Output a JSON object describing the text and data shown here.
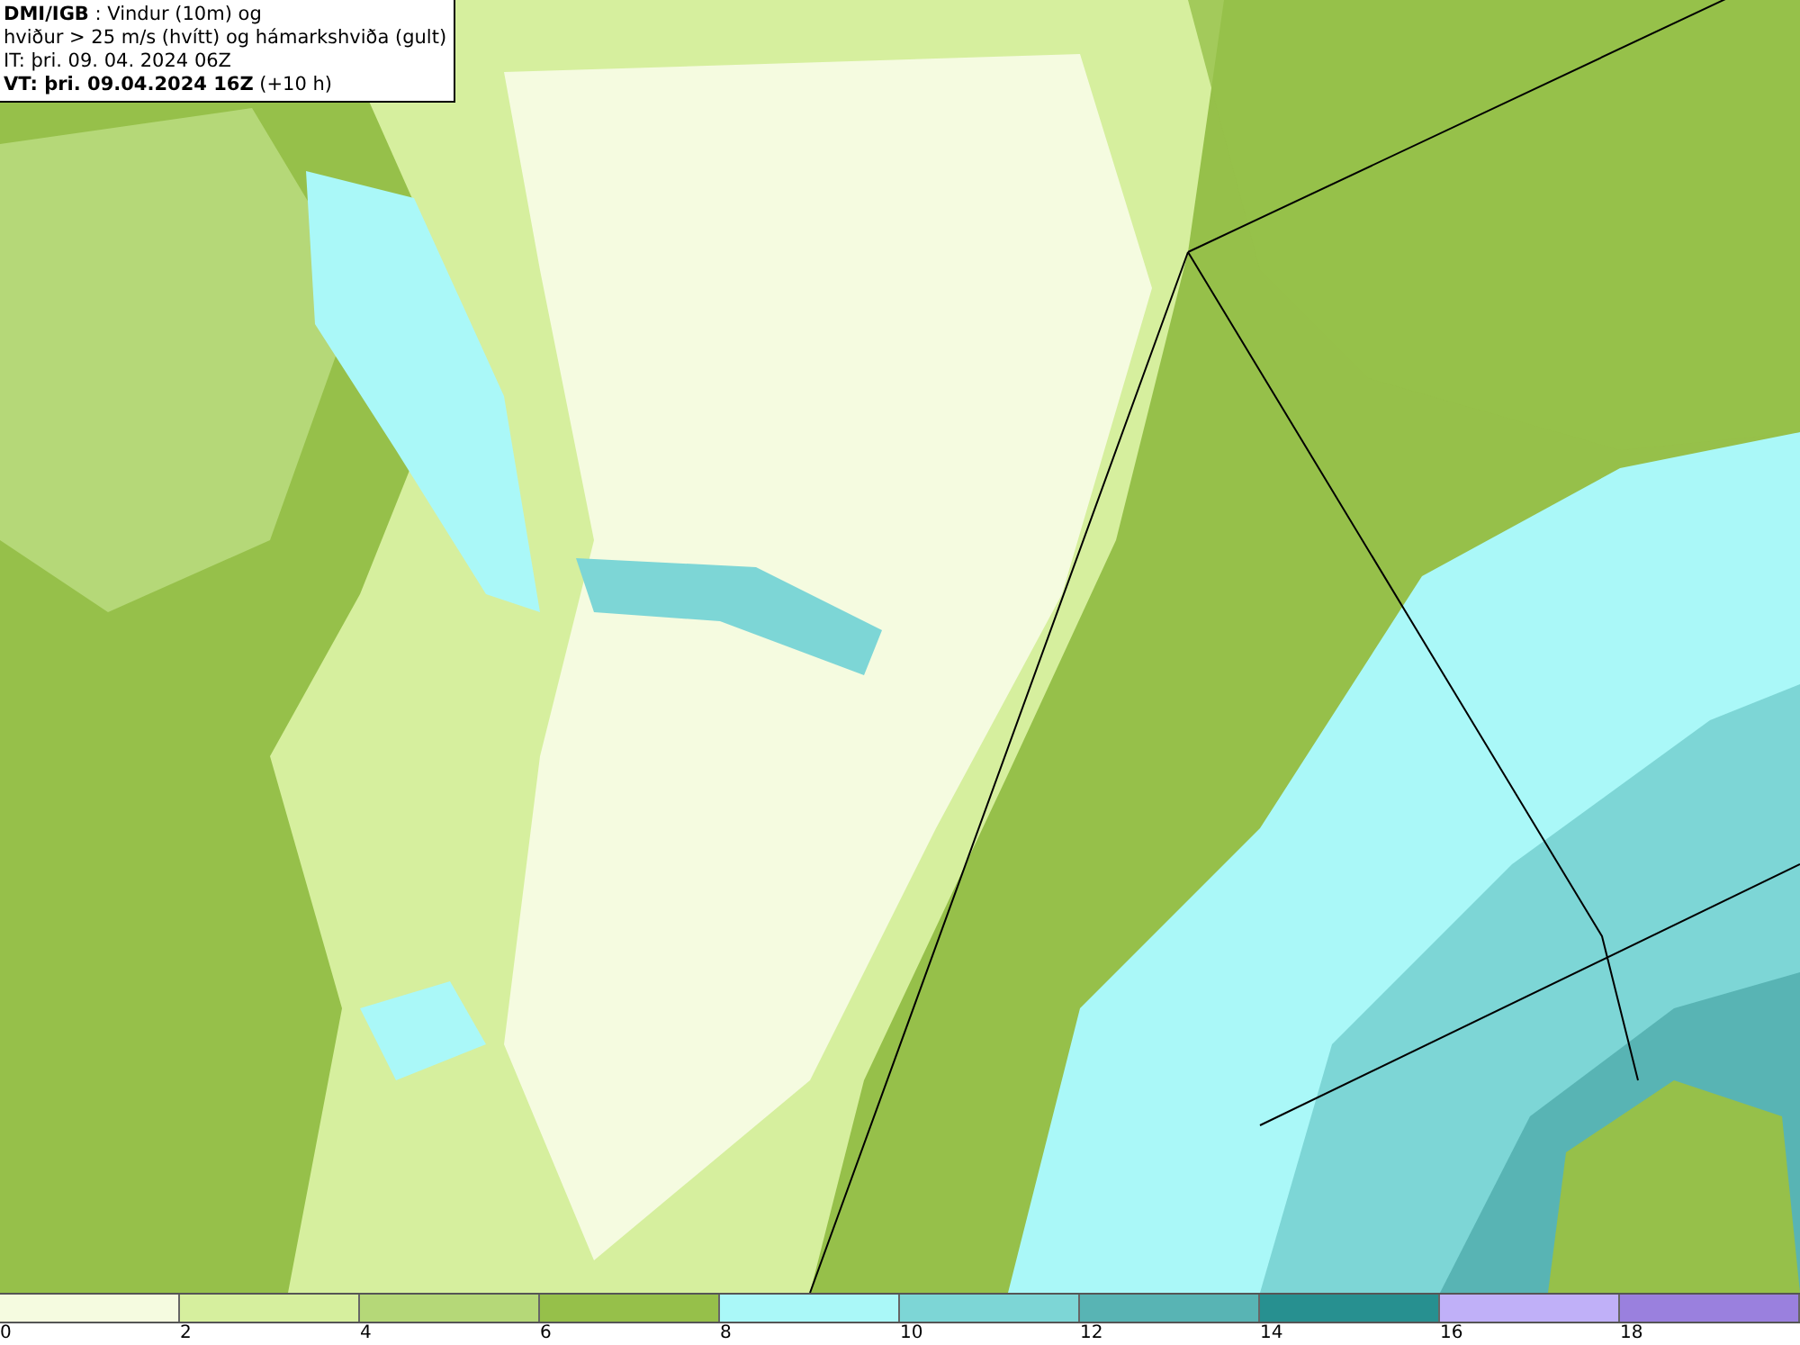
{
  "title_box": {
    "lines": [
      "**DMI/IGB** : Vindur (10m) og",
      "hviður > 25 m/s (hvítt) og hámarkshviða (gult)",
      "IT: þri. 09. 04. 2024 06Z",
      "**VT: þri. 09.04.2024 16Z** (+10 h)"
    ]
  },
  "legend": {
    "bins": [
      {
        "color": "#f5fbe0"
      },
      {
        "color": "#d6ef9e"
      },
      {
        "color": "#b5d878"
      },
      {
        "color": "#96c04a"
      },
      {
        "color": "#aaf8f8"
      },
      {
        "color": "#7dd6d6"
      },
      {
        "color": "#58b4b4"
      },
      {
        "color": "#279090"
      },
      {
        "color": "#c0b0f8"
      },
      {
        "color": "#9a80de"
      }
    ],
    "ticks": [
      "0",
      "2",
      "4",
      "6",
      "8",
      "10",
      "12",
      "14",
      "16",
      "18"
    ]
  }
}
